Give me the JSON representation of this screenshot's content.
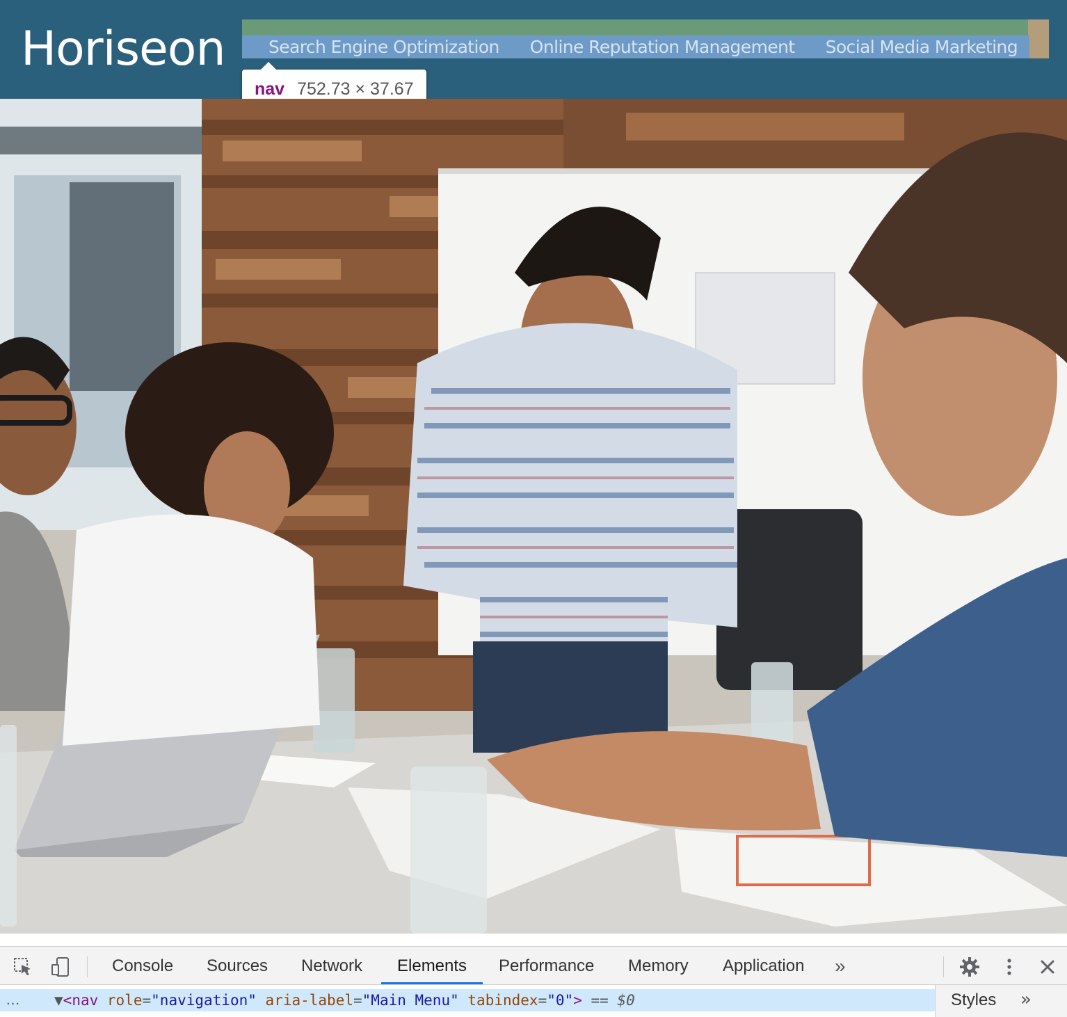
{
  "site": {
    "logo": "Horiseon",
    "nav": [
      "Search Engine Optimization",
      "Online Reputation Management",
      "Social Media Marketing"
    ]
  },
  "inspector_tooltip": {
    "tag": "nav",
    "size": "752.73 × 37.67"
  },
  "devtools": {
    "icons": [
      "inspect-element-icon",
      "device-toolbar-icon"
    ],
    "tabs": [
      "Console",
      "Sources",
      "Network",
      "Elements",
      "Performance",
      "Memory",
      "Application"
    ],
    "active_tab": "Elements",
    "more_tabs": "»",
    "right_icons": [
      "gear-icon",
      "more-vertical-icon",
      "close-icon"
    ],
    "dom": {
      "ellipsis": "…",
      "tag": "nav",
      "attrs": [
        {
          "name": "role",
          "value": "navigation"
        },
        {
          "name": "aria-label",
          "value": "Main Menu"
        },
        {
          "name": "tabindex",
          "value": "0"
        }
      ],
      "selected_marker": "== $0"
    },
    "styles_tab": "Styles",
    "styles_more": "»"
  },
  "colors": {
    "header_bg": "#2a607c",
    "nav_highlight": "#6e9ac7",
    "margin_highlight": "#6b9a79",
    "padding_highlight": "#b39d7a",
    "active_tab_underline": "#1a73e8",
    "selected_row": "#cfe8fc"
  }
}
